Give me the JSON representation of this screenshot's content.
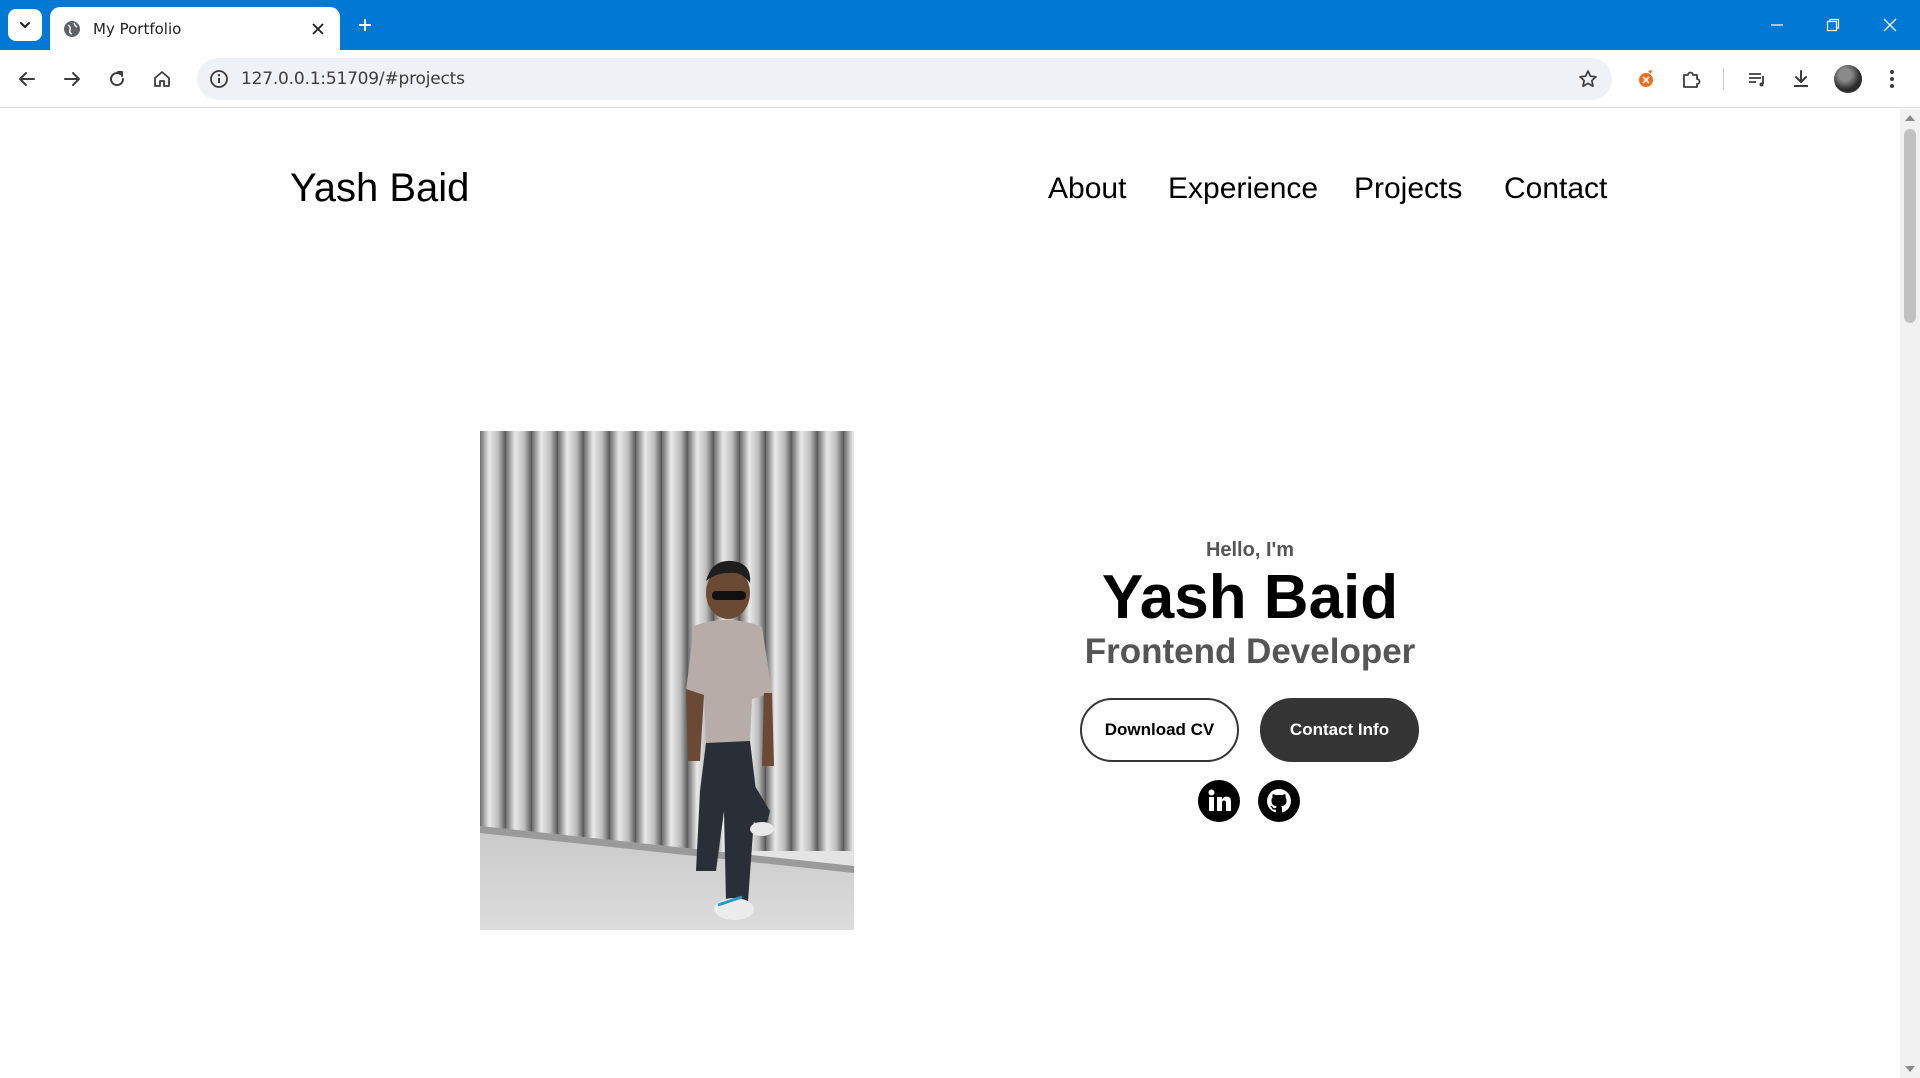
{
  "browser": {
    "tab_title": "My Portfolio",
    "url": "127.0.0.1:51709/#projects",
    "accent": "#0078d4"
  },
  "page": {
    "logo": "Yash Baid",
    "nav": [
      "About",
      "Experience",
      "Projects",
      "Contact"
    ],
    "hero": {
      "greeting": "Hello, I'm",
      "name": "Yash Baid",
      "role": "Frontend Developer",
      "download_cv": "Download CV",
      "contact_info": "Contact Info",
      "socials": [
        "linkedin-icon",
        "github-icon"
      ]
    },
    "colors": {
      "text": "#000000",
      "muted": "#555555",
      "button_dark": "#353535"
    }
  }
}
